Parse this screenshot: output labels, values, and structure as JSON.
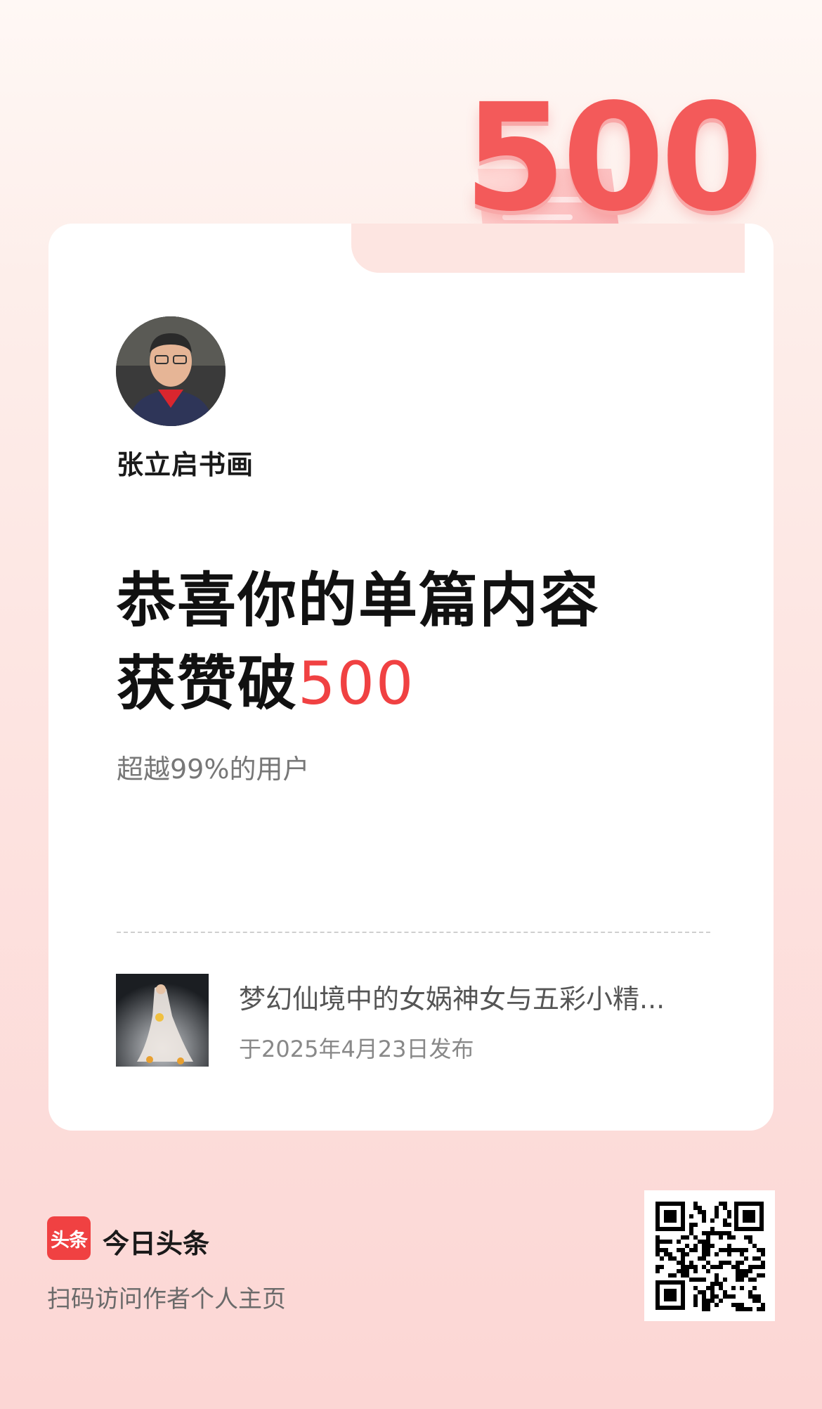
{
  "badge": {
    "number": "500"
  },
  "author": {
    "name": "张立启书画"
  },
  "headline": {
    "line1": "恭喜你的单篇内容",
    "line2_prefix": "获赞破",
    "line2_number": "500"
  },
  "subtitle": "超越99%的用户",
  "post": {
    "title": "梦幻仙境中的女娲神女与五彩小精...",
    "date": "于2025年4月23日发布"
  },
  "footer": {
    "logo_text": "头条",
    "app_name": "今日头条",
    "qr_caption": "扫码访问作者个人主页"
  },
  "colors": {
    "accent": "#f04142",
    "badge": "#f35a5a"
  },
  "icons": {
    "heart": "heart-icon",
    "scroll": "scroll-icon"
  }
}
